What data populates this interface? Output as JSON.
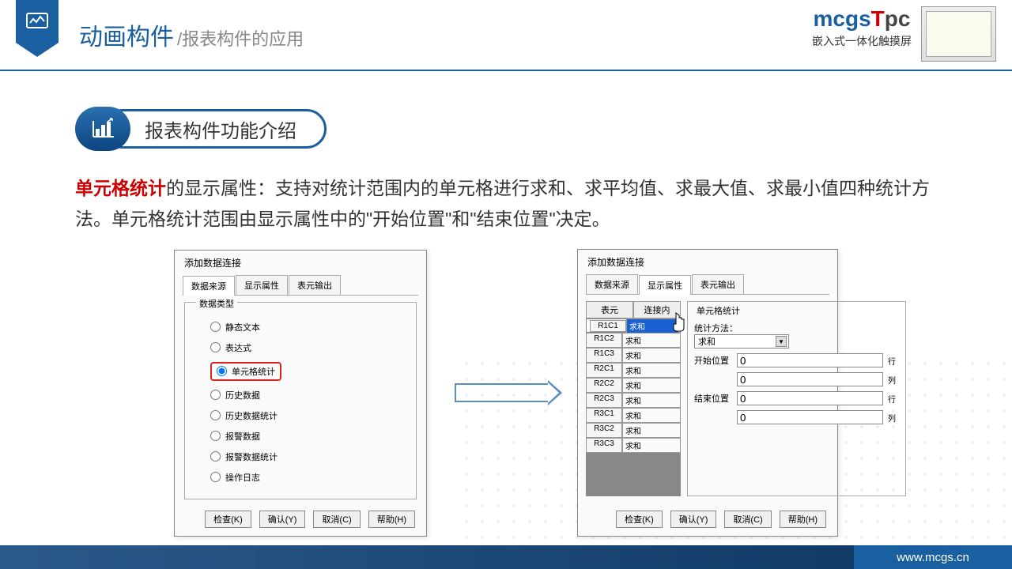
{
  "title_main": "动画构件",
  "title_sub": "/报表构件的应用",
  "logo": "mcgs",
  "logo_t": "T",
  "logo_pc": "pc",
  "logo_tag": "嵌入式一体化触摸屏",
  "section": "报表构件功能介绍",
  "desc_hl": "单元格统计",
  "desc_rest": "的显示属性：支持对统计范围内的单元格进行求和、求平均值、求最大值、求最小值四种统计方法。单元格统计范围由显示属性中的\"开始位置\"和\"结束位置\"决定。",
  "dlg1": {
    "title": "添加数据连接",
    "tabs": [
      "数据来源",
      "显示属性",
      "表元输出"
    ],
    "active_tab": 0,
    "fieldset": "数据类型",
    "radios": [
      "静态文本",
      "表达式",
      "单元格统计",
      "历史数据",
      "历史数据统计",
      "报警数据",
      "报警数据统计",
      "操作日志"
    ],
    "selected": 2
  },
  "dlg2": {
    "title": "添加数据连接",
    "tabs": [
      "数据来源",
      "显示属性",
      "表元输出"
    ],
    "active_tab": 1,
    "col1": "表元",
    "col2": "连接内",
    "rows": [
      {
        "c": "R1C1",
        "v": "求和"
      },
      {
        "c": "R1C2",
        "v": "求和"
      },
      {
        "c": "R1C3",
        "v": "求和"
      },
      {
        "c": "R2C1",
        "v": "求和"
      },
      {
        "c": "R2C2",
        "v": "求和"
      },
      {
        "c": "R2C3",
        "v": "求和"
      },
      {
        "c": "R3C1",
        "v": "求和"
      },
      {
        "c": "R3C2",
        "v": "求和"
      },
      {
        "c": "R3C3",
        "v": "求和"
      }
    ],
    "stats_title": "单元格统计",
    "method_lbl": "统计方法：",
    "method_val": "求和",
    "start_lbl": "开始位置",
    "end_lbl": "结束位置",
    "row_suf": "行",
    "col_suf": "列",
    "start_row": "0",
    "start_col": "0",
    "end_row": "0",
    "end_col": "0"
  },
  "btns": {
    "check": "检查(K)",
    "ok": "确认(Y)",
    "cancel": "取消(C)",
    "help": "帮助(H)"
  },
  "footer": "www.mcgs.cn"
}
